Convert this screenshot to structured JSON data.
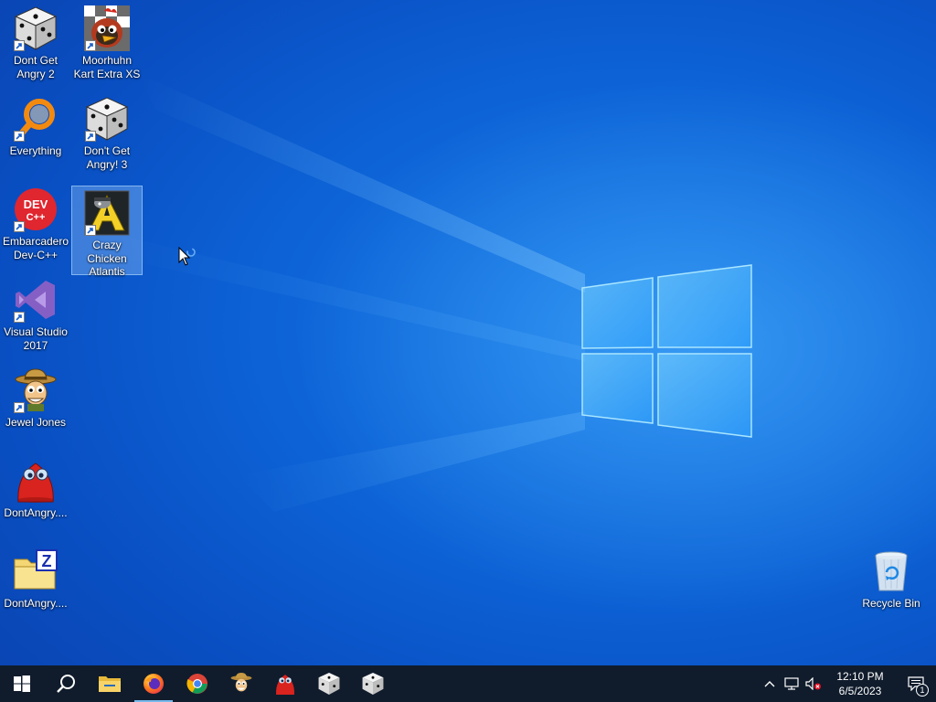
{
  "desktop": {
    "icons": [
      {
        "label": "Dont Get Angry 2",
        "icon": "dice-icon"
      },
      {
        "label": "Moorhuhn Kart Extra XS",
        "icon": "moorhuhn-chicken-icon"
      },
      {
        "label": "Everything",
        "icon": "everything-search-icon"
      },
      {
        "label": "Don't Get Angry! 3",
        "icon": "dice-icon"
      },
      {
        "label": "Embarcadero Dev-C++",
        "icon": "devcpp-icon"
      },
      {
        "label": "Crazy Chicken Atlantis",
        "icon": "crazy-chicken-atlantis-icon",
        "selected": true
      },
      {
        "label": "Visual Studio 2017",
        "icon": "visual-studio-icon"
      },
      {
        "label": "Jewel Jones",
        "icon": "jewel-jones-icon"
      },
      {
        "label": "DontAngry....",
        "icon": "red-blob-icon"
      },
      {
        "label": "DontAngry....",
        "icon": "zip-folder-icon"
      },
      {
        "label": "Recycle Bin",
        "icon": "recycle-bin-icon"
      }
    ]
  },
  "taskbar": {
    "apps": [
      {
        "name": "Start",
        "icon": "windows-start-icon"
      },
      {
        "name": "Search",
        "icon": "search-icon"
      },
      {
        "name": "File Explorer",
        "icon": "file-explorer-icon"
      },
      {
        "name": "Firefox",
        "icon": "firefox-icon",
        "active": true
      },
      {
        "name": "Chrome",
        "icon": "chrome-icon"
      },
      {
        "name": "Jewel Jones",
        "icon": "jewel-jones-icon"
      },
      {
        "name": "DontAngry",
        "icon": "red-blob-icon"
      },
      {
        "name": "Dont Get Angry 2",
        "icon": "dice-icon"
      },
      {
        "name": "Don't Get Angry! 3",
        "icon": "dice-icon"
      }
    ],
    "tray": {
      "time": "12:10 PM",
      "date": "6/5/2023",
      "notification_count": "1",
      "icons": [
        "chevron-up-icon",
        "network-icon",
        "speaker-muted-icon"
      ]
    }
  },
  "colors": {
    "wallpaper": "#0a5ed1",
    "taskbar": "#101c2c",
    "active_indicator": "#76b9ed"
  }
}
